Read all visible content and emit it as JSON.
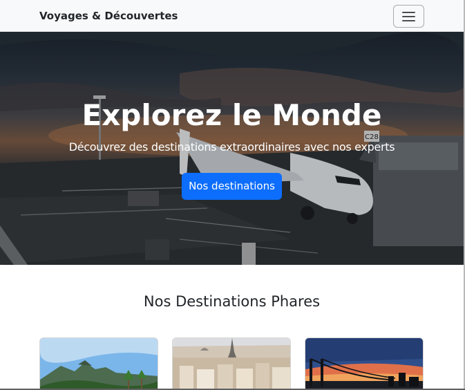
{
  "navbar": {
    "brand": "Voyages & Découvertes",
    "toggler_icon": "hamburger-menu-icon"
  },
  "hero": {
    "title": "Explorez le Monde",
    "subtitle": "Découvrez des destinations extraordinaires avec nos experts",
    "button_label": "Nos destinations",
    "image_subject": "airplane-at-airport-gate-sunset",
    "gate_sign": "C28"
  },
  "destinations": {
    "title": "Nos Destinations Phares",
    "cards": [
      {
        "image_subject": "tropical-island-mountains-palms"
      },
      {
        "image_subject": "paris-cityscape-eiffel-tower"
      },
      {
        "image_subject": "bridge-at-sunset-skyline"
      }
    ]
  },
  "colors": {
    "primary": "#0d6efd",
    "navbar_bg": "#f8f9fa",
    "text": "#212529"
  }
}
